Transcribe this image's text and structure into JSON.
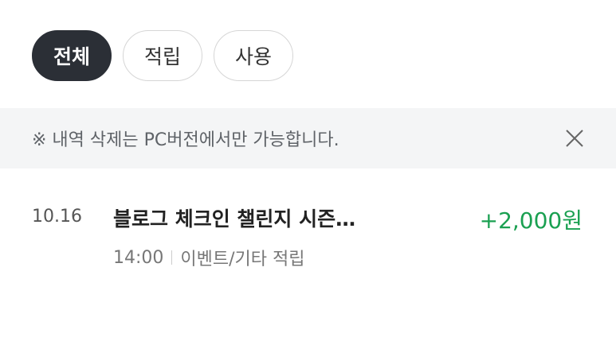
{
  "filters": [
    {
      "label": "전체",
      "active": true
    },
    {
      "label": "적립",
      "active": false
    },
    {
      "label": "사용",
      "active": false
    }
  ],
  "notice": {
    "text": "※ 내역 삭제는 PC버전에서만 가능합니다.",
    "close_icon": "close-icon"
  },
  "history": [
    {
      "date": "10.16",
      "title": "블로그 체크인 챌린지 시즌…",
      "amount": "+2,000원",
      "time": "14:00",
      "category": "이벤트/기타 적립"
    }
  ],
  "colors": {
    "active_chip": "#2b2f36",
    "amount_positive": "#1aa051",
    "notice_bg": "#f4f5f6"
  }
}
